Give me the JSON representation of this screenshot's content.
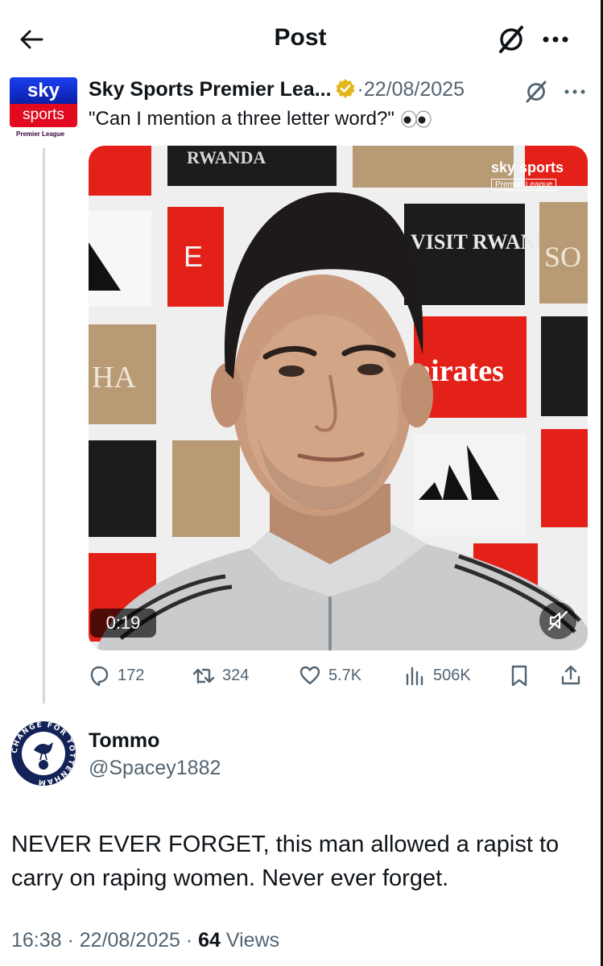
{
  "header": {
    "title": "Post"
  },
  "quoted_post": {
    "avatar": {
      "brand_top": "sky",
      "brand_bottom": "sports",
      "subtitle": "Premier League"
    },
    "author_name": "Sky Sports Premier Lea...",
    "date": "·22/08/2025",
    "text": "\"Can I mention a three letter word?\"",
    "video": {
      "duration": "0:19",
      "watermark_top": "sky sports",
      "watermark_bottom": "Premier League",
      "board_texts": [
        "RWANDA",
        "VISIT RWANDA",
        "nirates",
        "HA",
        "SO",
        "E"
      ]
    },
    "stats": {
      "replies": "172",
      "reposts": "324",
      "likes": "5.7K",
      "views": "506K"
    }
  },
  "reply": {
    "name": "Tommo",
    "handle": "@Spacey1882",
    "avatar_text": "CHANGE FOR TOTTENHAM",
    "text": "NEVER EVER FORGET, this man allowed a rapist to carry on raping women. Never ever forget.",
    "time": "16:38 · 22/08/2025 · ",
    "view_count": "64",
    "views_label": " Views"
  },
  "colors": {
    "text": "#0f1419",
    "secondary": "#536471",
    "verified_gold": "#e2b719",
    "sky_blue": "#1a3ff0",
    "sky_red": "#e10a1e",
    "arsenal_red": "#e32119"
  },
  "icons": [
    "back-arrow-icon",
    "grok-icon",
    "more-icon",
    "verified-badge-icon",
    "reply-icon",
    "repost-icon",
    "like-icon",
    "views-icon",
    "bookmark-icon",
    "share-icon",
    "mute-icon"
  ]
}
